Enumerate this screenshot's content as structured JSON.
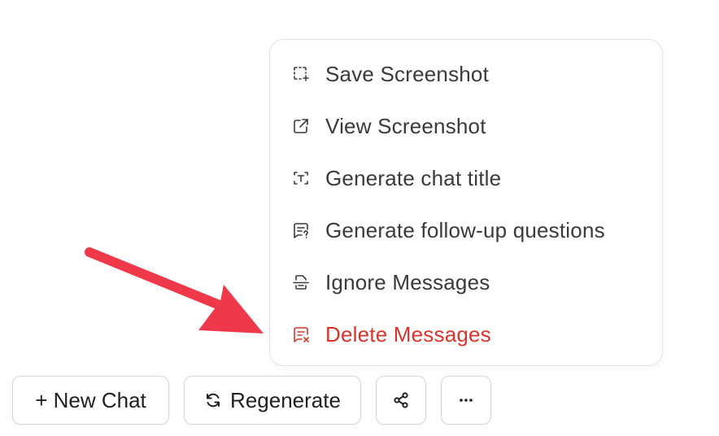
{
  "context_menu": {
    "items": [
      {
        "label": "Save Screenshot",
        "icon": "screenshot-select-icon"
      },
      {
        "label": "View Screenshot",
        "icon": "external-link-icon"
      },
      {
        "label": "Generate chat title",
        "icon": "text-select-icon"
      },
      {
        "label": "Generate follow-up questions",
        "icon": "chat-question-icon"
      },
      {
        "label": "Ignore Messages",
        "icon": "strikethrough-doc-icon"
      },
      {
        "label": "Delete Messages",
        "icon": "chat-delete-icon",
        "color": "#d9342b"
      }
    ]
  },
  "toolbar": {
    "new_chat_label": "+ New Chat",
    "regenerate_label": "Regenerate",
    "share_icon": "share-icon",
    "more_icon": "more-horizontal-icon"
  },
  "annotation": {
    "arrow_color": "#f0384b"
  }
}
